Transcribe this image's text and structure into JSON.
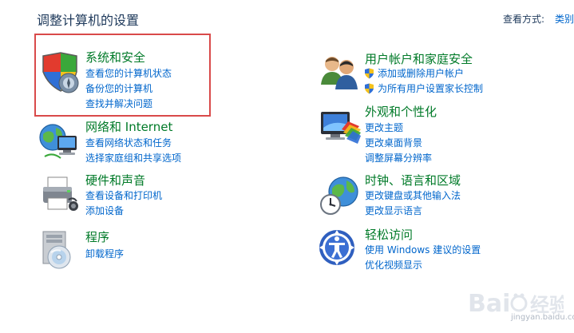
{
  "page": {
    "title": "调整计算机的设置",
    "view_by_label": "查看方式:",
    "view_by_value": "类别"
  },
  "categories": [
    {
      "id": "system-security",
      "title": "系统和安全",
      "icon": "shield-icon",
      "links": [
        "查看您的计算机状态",
        "备份您的计算机",
        "查找并解决问题"
      ]
    },
    {
      "id": "network-internet",
      "title": "网络和 Internet",
      "icon": "network-globe-icon",
      "links": [
        "查看网络状态和任务",
        "选择家庭组和共享选项"
      ]
    },
    {
      "id": "hardware-sound",
      "title": "硬件和声音",
      "icon": "printer-icon",
      "links": [
        "查看设备和打印机",
        "添加设备"
      ]
    },
    {
      "id": "programs",
      "title": "程序",
      "icon": "programs-disc-icon",
      "links": [
        "卸载程序"
      ]
    },
    {
      "id": "user-accounts",
      "title": "用户帐户和家庭安全",
      "icon": "users-icon",
      "links": [
        "添加或删除用户帐户",
        "为所有用户设置家长控制"
      ]
    },
    {
      "id": "appearance",
      "title": "外观和个性化",
      "icon": "monitor-palette-icon",
      "links": [
        "更改主题",
        "更改桌面背景",
        "调整屏幕分辨率"
      ]
    },
    {
      "id": "clock-region",
      "title": "时钟、语言和区域",
      "icon": "clock-globe-icon",
      "links": [
        "更改键盘或其他输入法",
        "更改显示语言"
      ]
    },
    {
      "id": "ease-access",
      "title": "轻松访问",
      "icon": "ease-of-access-icon",
      "links": [
        "使用 Windows 建议的设置",
        "优化视频显示"
      ]
    }
  ],
  "watermark": {
    "site": "jingyan.baidu.com"
  }
}
